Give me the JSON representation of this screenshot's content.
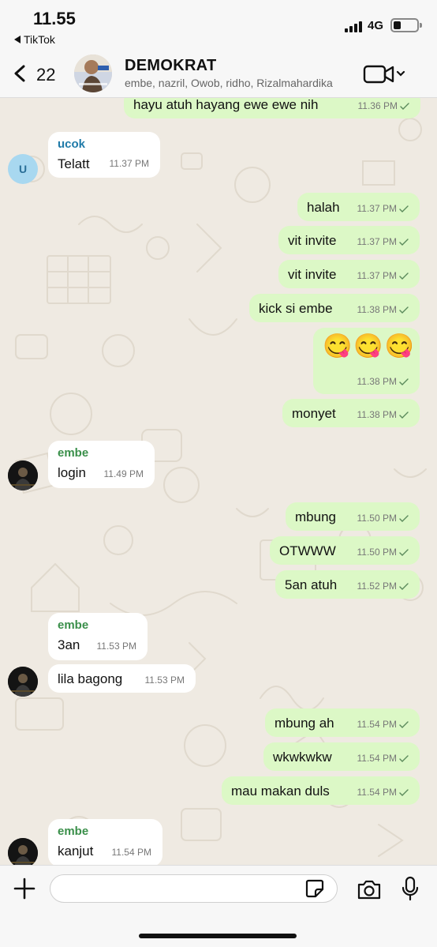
{
  "status_bar": {
    "time": "11.55",
    "back_app": "TikTok",
    "network": "4G"
  },
  "header": {
    "unread_count": "22",
    "group_name": "DEMOKRAT",
    "members": "embe, nazril, Owob, ridho, Rizalmahardika"
  },
  "messages": [
    {
      "dir": "out",
      "text": "hayu atuh hayang ewe ewe nih",
      "time": "11.36 PM"
    },
    {
      "dir": "in",
      "sender": "ucok",
      "text": "Telatt",
      "time": "11.37 PM",
      "avatar_letter": "U"
    },
    {
      "dir": "out",
      "text": "halah",
      "time": "11.37 PM"
    },
    {
      "dir": "out",
      "text": "vit invite",
      "time": "11.37 PM"
    },
    {
      "dir": "out",
      "text": "vit invite",
      "time": "11.37 PM"
    },
    {
      "dir": "out",
      "text": "kick si embe",
      "time": "11.38 PM"
    },
    {
      "dir": "out",
      "text": "😋😋😋",
      "time": "11.38 PM"
    },
    {
      "dir": "out",
      "text": "monyet",
      "time": "11.38 PM"
    },
    {
      "dir": "in",
      "sender": "embe",
      "text": "login",
      "time": "11.49 PM"
    },
    {
      "dir": "out",
      "text": "mbung",
      "time": "11.50 PM"
    },
    {
      "dir": "out",
      "text": "OTWWW",
      "time": "11.50 PM"
    },
    {
      "dir": "out",
      "text": "5an atuh",
      "time": "11.52 PM"
    },
    {
      "dir": "in",
      "sender": "embe",
      "text": "3an",
      "time": "11.53 PM"
    },
    {
      "dir": "in",
      "text": "lila bagong",
      "time": "11.53 PM"
    },
    {
      "dir": "out",
      "text": "mbung ah",
      "time": "11.54 PM"
    },
    {
      "dir": "out",
      "text": "wkwkwkw",
      "time": "11.54 PM"
    },
    {
      "dir": "out",
      "text": "mau makan duls",
      "time": "11.54 PM"
    },
    {
      "dir": "in",
      "sender": "embe",
      "text": "kanjut",
      "time": "11.54 PM"
    }
  ],
  "composer": {
    "placeholder": ""
  },
  "colors": {
    "outgoing_bubble": "#dcf8c6",
    "incoming_bubble": "#ffffff",
    "chat_background": "#efeae2",
    "sender_ucok": "#1f7aa8",
    "sender_embe": "#3a8f4a",
    "read_tick": "#5b8a5b"
  },
  "icons": [
    "chevron-left-icon",
    "video-call-icon",
    "chevron-down-icon",
    "plus-icon",
    "sticker-icon",
    "camera-icon",
    "microphone-icon",
    "double-check-icon"
  ]
}
